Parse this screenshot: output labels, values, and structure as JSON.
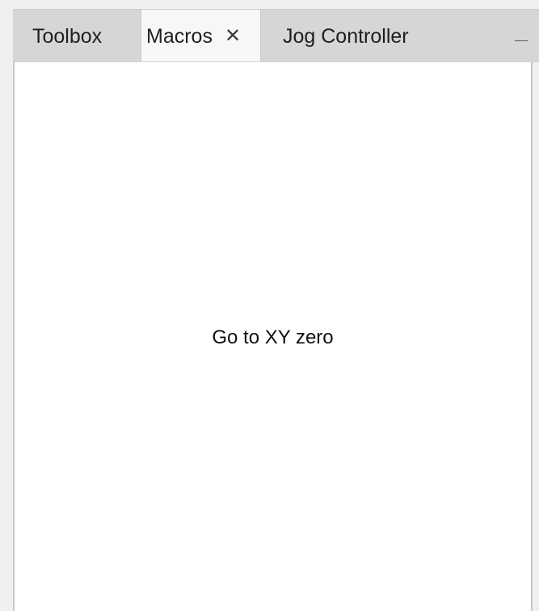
{
  "tabs": [
    {
      "label": "Toolbox",
      "active": false
    },
    {
      "label": "Macros",
      "active": true,
      "close_glyph": "✕"
    },
    {
      "label": "Jog Controller",
      "active": false
    }
  ],
  "panel": {
    "macro_label": "Go to XY zero"
  },
  "icons": {
    "close": "close-icon",
    "minimize": "minimize-icon"
  },
  "colors": {
    "tabstrip_bg": "#d6d6d6",
    "active_tab_bg": "#f7f7f7",
    "panel_bg": "#ffffff",
    "text": "#1f1f1f"
  }
}
